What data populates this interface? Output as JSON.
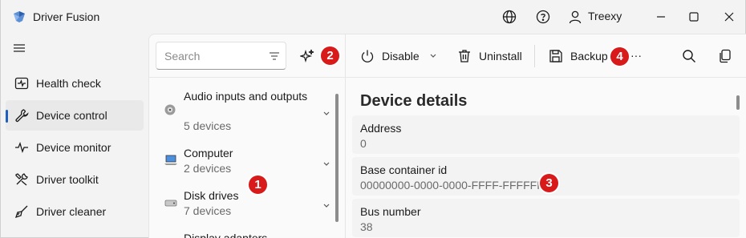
{
  "app": {
    "title": "Driver Fusion",
    "user": "Treexy",
    "colors": {
      "accent": "#1f5fbf",
      "badge": "#d81a1a",
      "background": "#f3f3f3"
    }
  },
  "sidebar": {
    "items": [
      {
        "label": "Health check",
        "icon": "heart-pulse-icon"
      },
      {
        "label": "Device control",
        "icon": "wrench-icon",
        "active": true
      },
      {
        "label": "Device monitor",
        "icon": "pulse-icon"
      },
      {
        "label": "Driver toolkit",
        "icon": "tools-icon"
      },
      {
        "label": "Driver cleaner",
        "icon": "broom-icon"
      }
    ]
  },
  "search": {
    "placeholder": "Search",
    "value": ""
  },
  "toolbar": {
    "disable_label": "Disable",
    "uninstall_label": "Uninstall",
    "backup_label": "Backup",
    "more_label": "···"
  },
  "badges": [
    "1",
    "2",
    "3",
    "4"
  ],
  "categories": [
    {
      "name": "Audio inputs and outputs",
      "count": "5 devices"
    },
    {
      "name": "Computer",
      "count": "2 devices"
    },
    {
      "name": "Disk drives",
      "count": "7 devices"
    },
    {
      "name": "Display adapters"
    }
  ],
  "details": {
    "title": "Device details",
    "rows": [
      {
        "label": "Address",
        "value": "0"
      },
      {
        "label": "Base container id",
        "value": "00000000-0000-0000-FFFF-FFFFFFFF"
      },
      {
        "label": "Bus number",
        "value": "38"
      }
    ]
  }
}
